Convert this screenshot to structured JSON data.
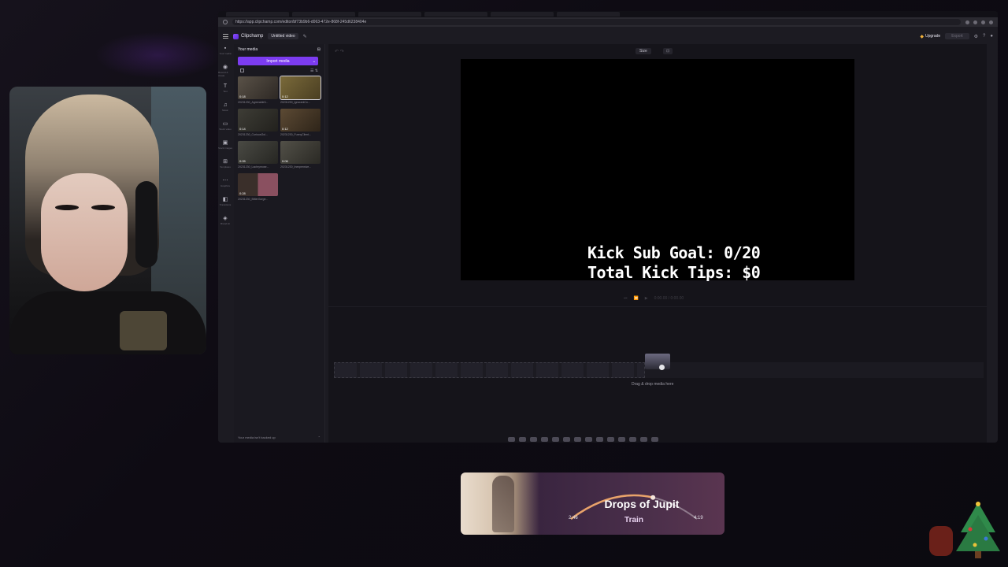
{
  "browser": {
    "url": "https://app.clipchamp.com/editor/bf73b9b6-d063-472e-868f-245d6238404e",
    "tabs": [
      "",
      "",
      "",
      "",
      "",
      "",
      ""
    ]
  },
  "app": {
    "logo": "Clipchamp",
    "project_title": "Untitled video",
    "upgrade_label": "Upgrade",
    "export_label": "Export"
  },
  "rail": [
    {
      "icon": "▪",
      "label": "Your media"
    },
    {
      "icon": "◉",
      "label": "Record & create"
    },
    {
      "icon": "T",
      "label": "Text"
    },
    {
      "icon": "♫",
      "label": "Music"
    },
    {
      "icon": "▭",
      "label": "Stock video"
    },
    {
      "icon": "▣",
      "label": "Stock images"
    },
    {
      "icon": "⊞",
      "label": "Templates"
    },
    {
      "icon": "⋯",
      "label": "Graphics"
    },
    {
      "icon": "◧",
      "label": "Transitions"
    },
    {
      "icon": "◈",
      "label": "Brand kit"
    }
  ],
  "panel": {
    "title": "Your media",
    "import_label": "Import media",
    "footer": "Your media isn't backed up",
    "items": [
      {
        "duration": "0:18",
        "name": "20231230_Agreeable3..."
      },
      {
        "duration": "0:12",
        "name": "20231230_IgnorantCo..."
      },
      {
        "duration": "0:14",
        "name": "20231230_CuriousGol..."
      },
      {
        "duration": "0:12",
        "name": "20231230_FunnyClient..."
      },
      {
        "duration": "0:05",
        "name": "20231230_Lachrymose..."
      },
      {
        "duration": "0:06",
        "name": "20231230_Inexpensive..."
      },
      {
        "duration": "0:28",
        "name": "20231230_BitterGorge..."
      }
    ]
  },
  "editor": {
    "size_label": "Size",
    "overlay_line1": "Kick Sub Goal: 0/20",
    "overlay_line2": "Total Kick Tips: $0",
    "timecode": "0:00.00 / 0:00.00",
    "drag_hint": "Drag & drop media here"
  },
  "music": {
    "title": "Drops of Jupit",
    "artist": "Train",
    "elapsed": "2:46",
    "total": "4:19",
    "progress": 0.64,
    "accent": "#e9a36a"
  }
}
